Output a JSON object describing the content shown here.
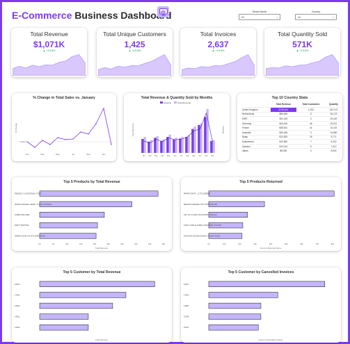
{
  "header": {
    "title_accent": "E-Commerce",
    "title_rest": " Business Dashboard",
    "logo_icon": "monitor-chart-icon"
  },
  "slicers": [
    {
      "label": "Select Month",
      "value": "All"
    },
    {
      "label": "Country",
      "value": "All"
    }
  ],
  "colors": {
    "accent": "#7c3aed",
    "bar_light": "#c4b5fd",
    "bar_mid": "#a78bfa",
    "area": "#d8c8fb",
    "positive": "#16a34a"
  },
  "kpis": [
    {
      "title": "Total Revenue",
      "value": "$1,071K",
      "change": "▲ +19.8%"
    },
    {
      "title": "Total Unique Customers",
      "value": "1,425",
      "change": "▲ +19.8%"
    },
    {
      "title": "Total Invoices",
      "value": "2,637",
      "change": "▲ +19.8%"
    },
    {
      "title": "Total Quantity Sold",
      "value": "571K",
      "change": "▲ +19.8%"
    }
  ],
  "kpi_sparklines": [
    [
      20,
      27,
      22,
      30,
      26,
      31,
      30,
      38,
      42,
      55,
      60,
      35
    ],
    [
      18,
      24,
      20,
      28,
      25,
      30,
      29,
      36,
      42,
      52,
      62,
      30
    ],
    [
      17,
      22,
      20,
      26,
      24,
      29,
      28,
      34,
      40,
      51,
      60,
      28
    ],
    [
      22,
      26,
      24,
      31,
      28,
      33,
      34,
      40,
      45,
      58,
      66,
      38
    ]
  ],
  "charts": {
    "pct_change": {
      "title": "% Change in Total Sales vs. January",
      "x": [
        "Jan",
        "Feb",
        "Mar",
        "Apr",
        "May",
        "Jun",
        "Jul",
        "Aug",
        "Sep",
        "Oct",
        "Nov",
        "Dec"
      ],
      "xticks": [
        "Jan",
        "Mar",
        "May",
        "Jul",
        "Sep",
        "Nov"
      ],
      "y": [
        0,
        -20,
        5,
        -10,
        15,
        8,
        10,
        35,
        28,
        65,
        120,
        -10
      ],
      "ylabel": "% Change",
      "zero_label": "0.00%"
    },
    "rev_qty": {
      "title": "Total Revenue & Quantity Sold by Months",
      "legend": [
        "Quantity",
        "Total Revenue"
      ],
      "categories": [
        "Jan",
        "Feb",
        "Mar",
        "Apr",
        "May",
        "Jun",
        "Jul",
        "Aug",
        "Sep",
        "Oct",
        "Nov",
        "Dec"
      ],
      "series": [
        {
          "name": "Quantity",
          "values": [
            35,
            28,
            38,
            30,
            40,
            34,
            36,
            40,
            60,
            70,
            90,
            30
          ]
        },
        {
          "name": "Total Revenue",
          "values": [
            40,
            32,
            42,
            34,
            46,
            38,
            40,
            44,
            66,
            74,
            110,
            32
          ]
        }
      ],
      "line": [
        30,
        25,
        34,
        28,
        38,
        33,
        34,
        40,
        55,
        60,
        100,
        28
      ],
      "ylabel_left": "Total Revenue",
      "ylabel_right": "Quantity"
    },
    "country_table": {
      "title": "Top 10 Country Stats",
      "columns": [
        "Total Revenue",
        "Total Customers",
        "Quantity"
      ],
      "rows": [
        {
          "country": "United Kingdom",
          "revenue": "$798,184",
          "customers": "1,203",
          "qty": "422,121"
        },
        {
          "country": "Netherlands",
          "revenue": "$85,546",
          "customers": "8",
          "qty": "54,123"
        },
        {
          "country": "EIRE",
          "revenue": "$51,418",
          "customers": "3",
          "qty": "15,420"
        },
        {
          "country": "Germany",
          "revenue": "$45,106",
          "customers": "45",
          "qty": "23,011"
        },
        {
          "country": "France",
          "revenue": "$38,541",
          "customers": "44",
          "qty": "22,115"
        },
        {
          "country": "Australia",
          "revenue": "$30,168",
          "customers": "3",
          "qty": "16,880"
        },
        {
          "country": "Spain",
          "revenue": "$12,633",
          "customers": "18",
          "qty": "5,771"
        },
        {
          "country": "Switzerland",
          "revenue": "$10,982",
          "customers": "7",
          "qty": "5,230"
        },
        {
          "country": "Sweden",
          "revenue": "$10,124",
          "customers": "5",
          "qty": "7,312"
        },
        {
          "country": "Japan",
          "revenue": "$8,436",
          "customers": "3",
          "qty": "6,540"
        }
      ]
    }
  },
  "chart_data": [
    {
      "type": "bar",
      "title": "Top 5 Products by Total Revenue",
      "categories": [
        "REGENCY CAKESTAND 3 TIER",
        "WHITE HANGING HEART T-LIGHT HOLDER",
        "JUMBO BAG RED",
        "PARTY BUNTING",
        "PAPER CHAIN KIT 50'S CHRISTMAS"
      ],
      "values": [
        43000,
        33500,
        23500,
        21000,
        20500
      ],
      "xlabel": "Total Revenue",
      "xlim": [
        0,
        45000
      ],
      "xticks": [
        "0K",
        "5K",
        "10K",
        "15K",
        "20K",
        "25K",
        "30K",
        "35K",
        "40K",
        "45K"
      ]
    },
    {
      "type": "bar",
      "title": "Top 5 Products Returned",
      "categories": [
        "PAPER CRAFT , LITTLE BIRDIE",
        "MEDIUM CERAMIC TOP STORAGE JAR",
        "SET OF 3 CAKE TINS PANTRY DESIGN",
        "FAIRY CAKE FLANNEL ASSORTED COLOUR",
        "ROTATING SILVER ANGELS T-LIGHT HLDR"
      ],
      "values": [
        80995,
        36000,
        25000,
        22000,
        21500
      ],
      "xlabel": "Count of Returned Items",
      "xlim": [
        0,
        80000
      ],
      "xticks": [
        "0K",
        "10K",
        "20K",
        "30K",
        "40K",
        "50K",
        "60K",
        "70K",
        "80K"
      ]
    },
    {
      "type": "bar",
      "title": "Top 5 Customer by Total Revenue",
      "categories": [
        "18102",
        "17450",
        "14646",
        "14911",
        "14156"
      ],
      "values": [
        260000,
        195000,
        165000,
        110000,
        110000
      ],
      "xlabel": "Total Revenue",
      "xlim": [
        0,
        280000
      ]
    },
    {
      "type": "bar",
      "title": "Top 5 Customer by Cancelled Invoices",
      "categories": [
        "14911",
        "17841",
        "14606",
        "13798",
        "15311"
      ],
      "values": [
        89,
        53,
        40,
        40,
        38
      ],
      "xlabel": "Count of Cancelled Invoices",
      "xlim": [
        0,
        95
      ]
    }
  ]
}
